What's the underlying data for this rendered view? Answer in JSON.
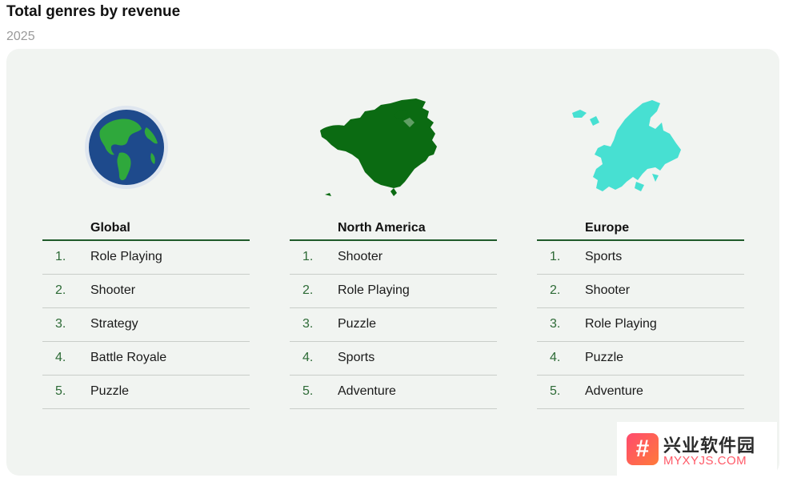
{
  "header": {
    "title": "Total genres by revenue",
    "subtitle": "2025"
  },
  "colors": {
    "accent": "#1f5a2a",
    "globe_ocean": "#1e4a8c",
    "globe_land": "#2fa83c",
    "north_america": "#0b6b12",
    "europe": "#47e0d2"
  },
  "regions": [
    {
      "name": "Global",
      "icon": "globe-icon",
      "rankings": [
        {
          "rank": "1.",
          "genre": "Role Playing"
        },
        {
          "rank": "2.",
          "genre": "Shooter"
        },
        {
          "rank": "3.",
          "genre": "Strategy"
        },
        {
          "rank": "4.",
          "genre": "Battle Royale"
        },
        {
          "rank": "5.",
          "genre": "Puzzle"
        }
      ]
    },
    {
      "name": "North America",
      "icon": "north-america-map-icon",
      "rankings": [
        {
          "rank": "1.",
          "genre": "Shooter"
        },
        {
          "rank": "2.",
          "genre": "Role Playing"
        },
        {
          "rank": "3.",
          "genre": "Puzzle"
        },
        {
          "rank": "4.",
          "genre": "Sports"
        },
        {
          "rank": "5.",
          "genre": "Adventure"
        }
      ]
    },
    {
      "name": "Europe",
      "icon": "europe-map-icon",
      "rankings": [
        {
          "rank": "1.",
          "genre": "Sports"
        },
        {
          "rank": "2.",
          "genre": "Shooter"
        },
        {
          "rank": "3.",
          "genre": "Role Playing"
        },
        {
          "rank": "4.",
          "genre": "Puzzle"
        },
        {
          "rank": "5.",
          "genre": "Adventure"
        }
      ]
    }
  ],
  "watermark": {
    "logo_glyph": "#",
    "text_cn": "兴业软件园",
    "text_en": "MYXYJS.COM"
  }
}
